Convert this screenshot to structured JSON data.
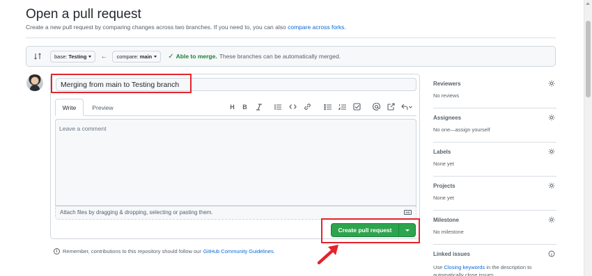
{
  "header": {
    "title": "Open a pull request",
    "subtitle": "Create a new pull request by comparing changes across two branches. If you need to, you can also",
    "subtitle_link": "compare across forks."
  },
  "compare": {
    "base_prefix": "base:",
    "base_branch": "Testing",
    "compare_prefix": "compare:",
    "compare_branch": "main",
    "merge_status": "Able to merge.",
    "merge_desc": "These branches can be automatically merged."
  },
  "form": {
    "title_value": "Merging from main to Testing branch",
    "tabs": [
      "Write",
      "Preview"
    ],
    "toolbar_icons": [
      "heading-icon",
      "bold-icon",
      "italic-icon",
      "quote-icon",
      "code-icon",
      "link-icon",
      "unordered-list-icon",
      "ordered-list-icon",
      "task-list-icon",
      "mention-icon",
      "reference-icon",
      "reply-icon"
    ],
    "comment_placeholder": "Leave a comment",
    "attach_text": "Attach files by dragging & dropping, selecting or pasting them.",
    "markdown_badge": "MD",
    "create_label": "Create pull request"
  },
  "guidelines": {
    "text": "Remember, contributions to this repository should follow our",
    "link": "GitHub Community Guidelines."
  },
  "sidebar": {
    "reviewers": {
      "label": "Reviewers",
      "value": "No reviews"
    },
    "assignees": {
      "label": "Assignees",
      "value": "No one—assign yourself"
    },
    "labels": {
      "label": "Labels",
      "value": "None yet"
    },
    "projects": {
      "label": "Projects",
      "value": "None yet"
    },
    "milestone": {
      "label": "Milestone",
      "value": "No milestone"
    },
    "linked_issues": {
      "label": "Linked issues",
      "value_pre": "Use",
      "value_link": "Closing keywords",
      "value_post": "in the description to automatically close issues"
    }
  },
  "colors": {
    "accent_green": "#2da44e",
    "link_blue": "#0969da",
    "highlight_red": "#e3242b",
    "merge_green": "#1a7f37"
  }
}
